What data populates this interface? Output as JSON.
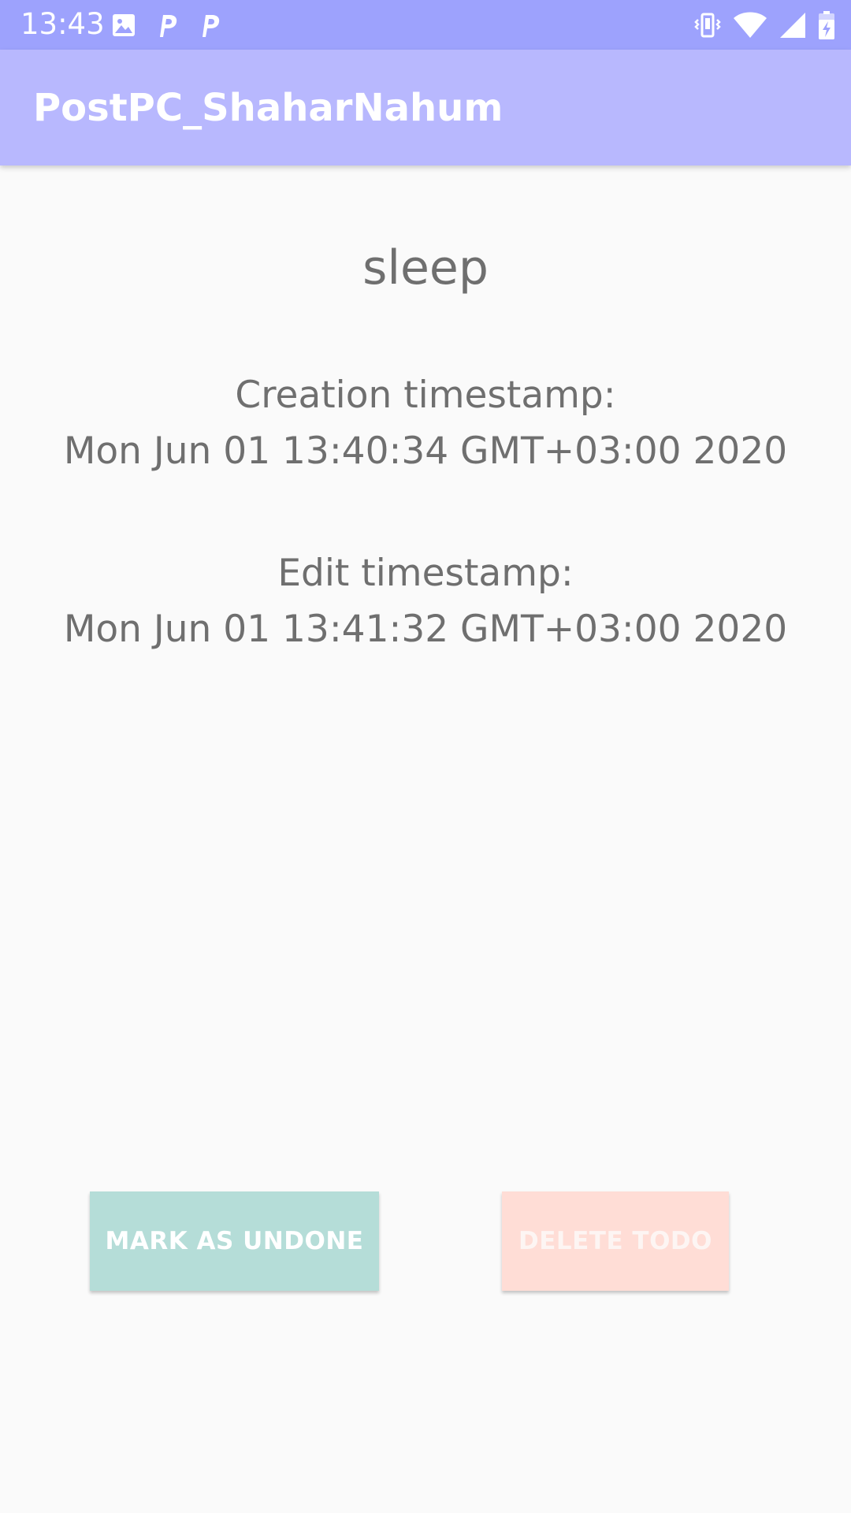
{
  "status_bar": {
    "time": "13:43",
    "left_icons": [
      "image-icon",
      "parking-p-icon",
      "parking-p-icon"
    ],
    "right_icons": [
      "vibrate-icon",
      "wifi-icon",
      "cell-signal-icon",
      "battery-charging-icon"
    ]
  },
  "app_bar": {
    "title": "PostPC_ShaharNahum"
  },
  "todo": {
    "title": "sleep",
    "creation_label": "Creation timestamp:",
    "creation_value": "Mon Jun 01 13:40:34 GMT+03:00 2020",
    "edit_label": "Edit timestamp:",
    "edit_value": "Mon Jun 01 13:41:32 GMT+03:00 2020"
  },
  "actions": {
    "mark_undone_label": "MARK AS UNDONE",
    "delete_label": "DELETE TODO"
  },
  "colors": {
    "status_bar": "#9da2fd",
    "app_bar": "#b8b8fe",
    "background": "#fafafa",
    "text": "#6f6f6f",
    "mark_undone_button": "#b5ddd8",
    "delete_button": "#ffddd6"
  }
}
